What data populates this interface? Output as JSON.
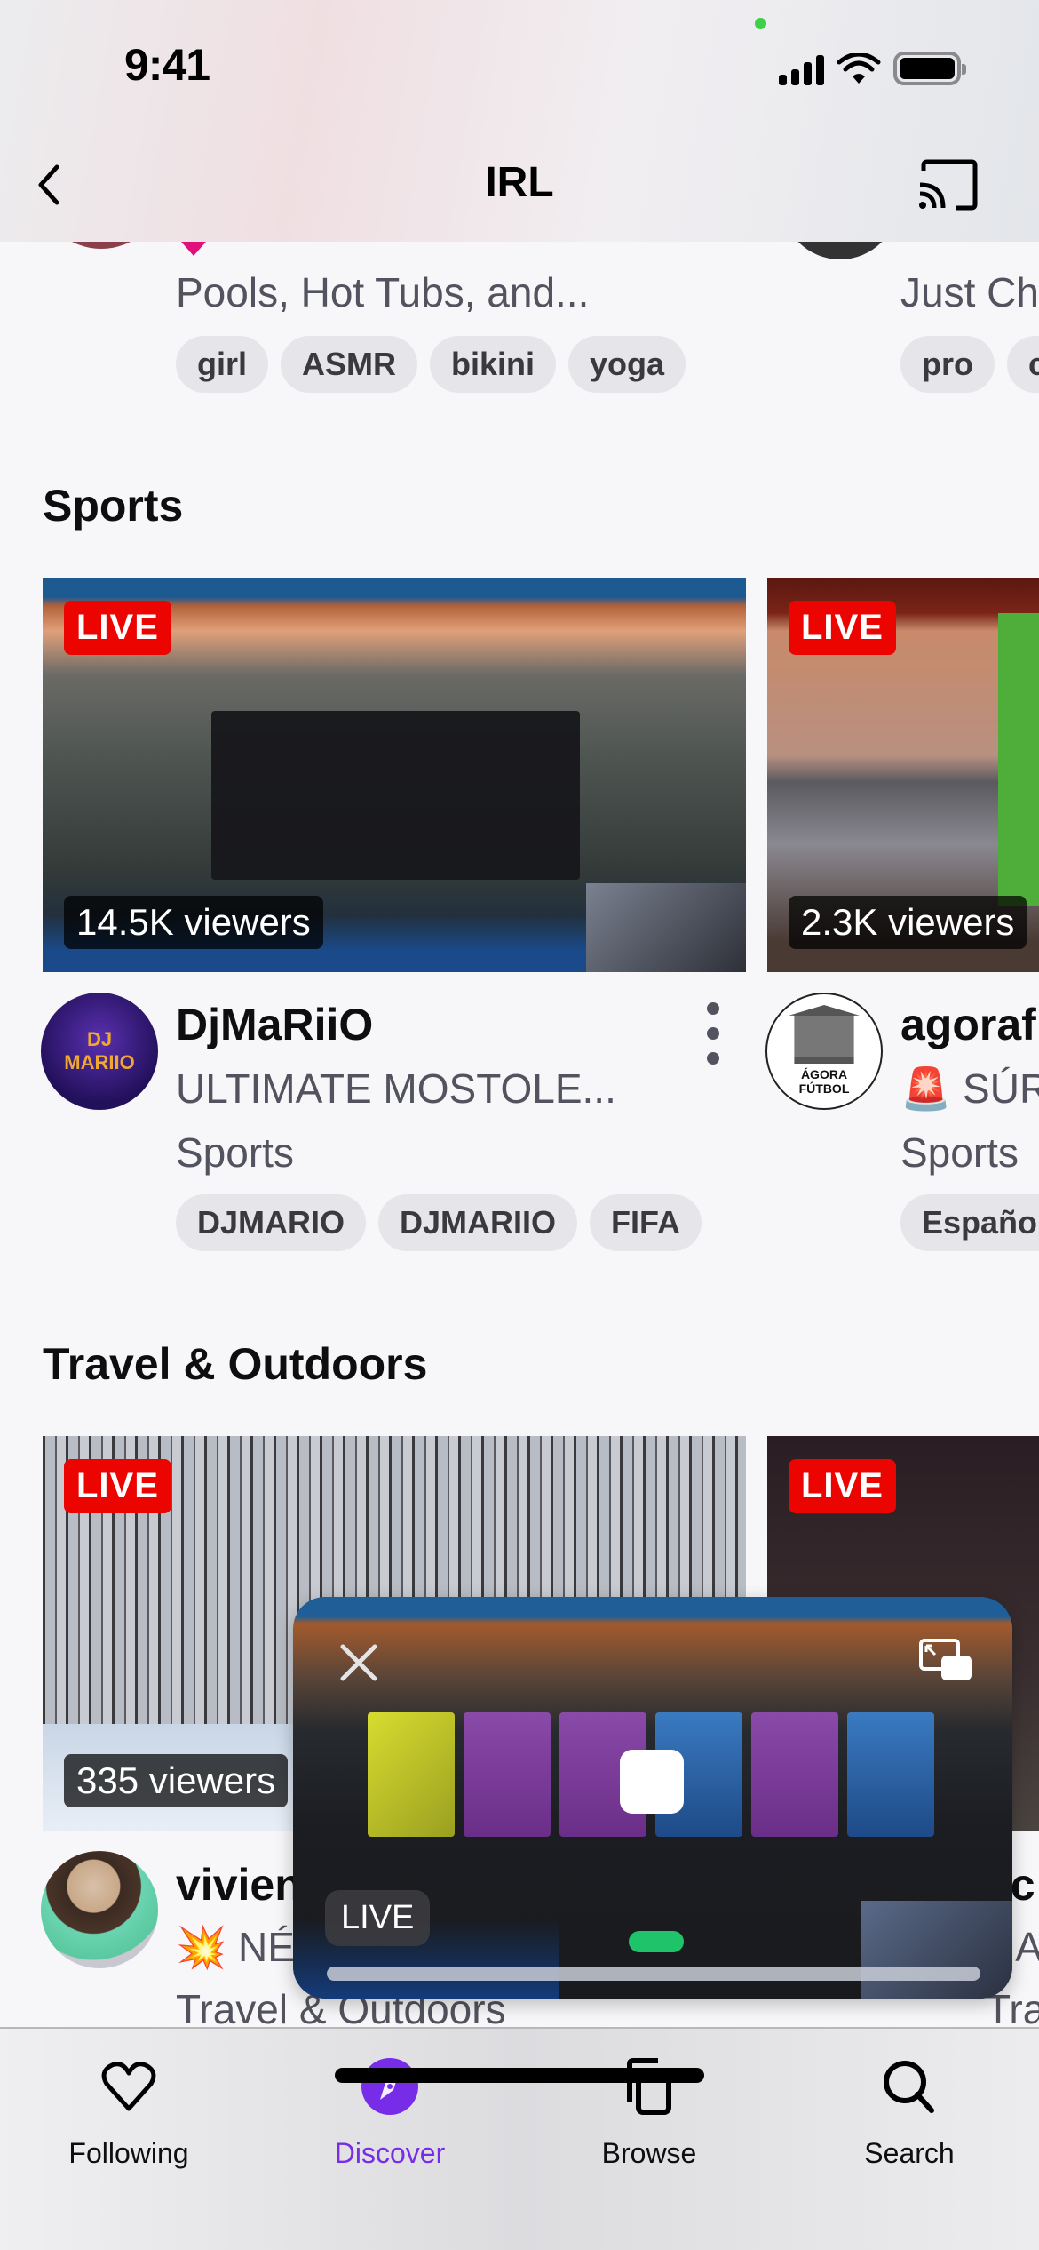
{
  "status_bar": {
    "time": "9:41"
  },
  "nav": {
    "title": "IRL",
    "back_icon": "chevron-left-icon",
    "cast_icon": "cast-icon"
  },
  "top_row": {
    "left": {
      "title": "Pools, Hot Tubs, and...",
      "tags": [
        "girl",
        "ASMR",
        "bikini",
        "yoga"
      ]
    },
    "right": {
      "title": "Just Ch",
      "tags": [
        "pro",
        "c"
      ]
    }
  },
  "sections": {
    "sports": {
      "title": "Sports",
      "cards": [
        {
          "live": "LIVE",
          "viewers": "14.5K viewers",
          "channel": "DjMaRiiO",
          "avatar_text": "DJ MARIIO",
          "stream_title": "ULTIMATE MOSTOLE...",
          "category": "Sports",
          "tags": [
            "DJMARIO",
            "DJMARIIO",
            "FIFA"
          ]
        },
        {
          "live": "LIVE",
          "viewers": "2.3K viewers",
          "channel": "agoraf",
          "avatar_text": "ÁGORA FÚTBOL",
          "stream_title": "🚨 SÚR",
          "category": "Sports",
          "tags": [
            "Español"
          ]
        }
      ]
    },
    "travel": {
      "title": "Travel & Outdoors",
      "cards": [
        {
          "live": "LIVE",
          "viewers": "335 viewers",
          "channel": "vivien",
          "stream_title": "💥 NÉ",
          "category": "Travel & Outdoors"
        },
        {
          "live": "LIVE",
          "channel": "ac",
          "stream_title": "NA",
          "category": "Travel"
        }
      ]
    }
  },
  "pip": {
    "live": "LIVE",
    "close_icon": "close-icon",
    "expand_icon": "pip-expand-icon"
  },
  "tab_bar": {
    "tabs": [
      {
        "label": "Following",
        "icon": "heart-icon",
        "active": false
      },
      {
        "label": "Discover",
        "icon": "compass-icon",
        "active": true
      },
      {
        "label": "Browse",
        "icon": "browse-icon",
        "active": false
      },
      {
        "label": "Search",
        "icon": "search-icon",
        "active": false
      }
    ]
  },
  "colors": {
    "accent": "#772ce8",
    "live_red": "#eb0400"
  }
}
